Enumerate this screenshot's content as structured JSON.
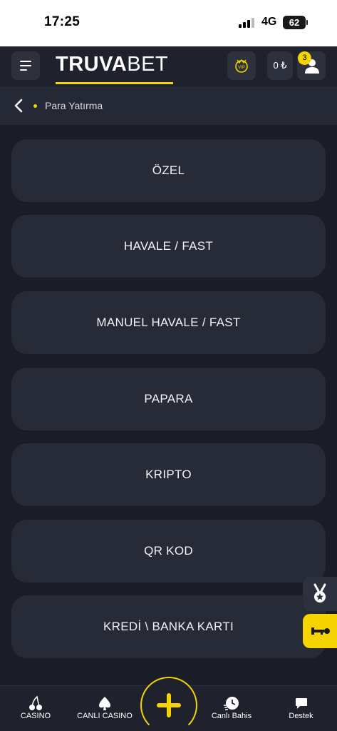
{
  "status": {
    "time": "17:25",
    "network": "4G",
    "battery": "62"
  },
  "header": {
    "logo_bold": "TRUVA",
    "logo_light": "BET",
    "balance": "0 ₺",
    "notification_count": "3"
  },
  "breadcrumb": {
    "label": "Para Yatırma"
  },
  "methods": [
    {
      "label": "ÖZEL"
    },
    {
      "label": "HAVALE / FAST"
    },
    {
      "label": "MANUEL HAVALE / FAST"
    },
    {
      "label": "PAPARA"
    },
    {
      "label": "KRIPTO"
    },
    {
      "label": "QR KOD"
    },
    {
      "label": "KREDİ \\ BANKA KARTI"
    }
  ],
  "nav": {
    "casino": "CASINO",
    "live_casino": "CANLI CASINO",
    "live_betting": "Canlı Bahis",
    "support": "Destek"
  },
  "colors": {
    "accent": "#f5d400",
    "background": "#1a1d27",
    "card": "#272a37"
  },
  "icons": [
    "menu-icon",
    "vip-icon",
    "user-icon",
    "back-chevron-icon",
    "medal-icon",
    "key-icon",
    "cherry-icon",
    "spade-icon",
    "plus-icon",
    "clock-icon",
    "chat-icon"
  ]
}
